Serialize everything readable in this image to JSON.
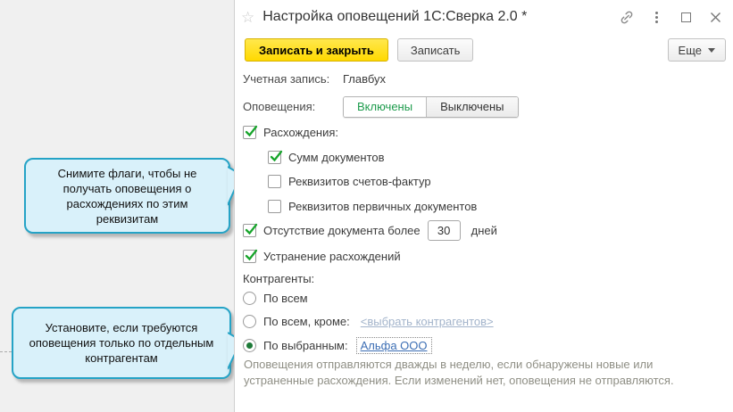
{
  "colors": {
    "accent_yellow": "#ffdd00",
    "check_green": "#18a52c",
    "toggle_green_text": "#1d9b4c",
    "callout_border": "#25a3c6",
    "callout_bg": "#d9f1fa",
    "link_blue": "#3c6eb4",
    "link_pale": "#a3b4cb",
    "footer_gray": "#8f8f85"
  },
  "window": {
    "title": "Настройка оповещений 1С:Сверка 2.0 *",
    "star_icon": "favorite-star-icon",
    "titlebar_icons": [
      "copy-link-icon",
      "kebab-menu-icon",
      "maximize-icon",
      "close-icon"
    ]
  },
  "toolbar": {
    "save_and_close": "Записать и закрыть",
    "save": "Записать",
    "more": "Еще"
  },
  "form": {
    "account": {
      "label": "Учетная запись:",
      "value": "Главбух"
    },
    "notifications": {
      "label": "Оповещения:",
      "enabled_option": "Включены",
      "disabled_option": "Выключены",
      "selected": "Включены"
    },
    "discrepancies": {
      "label": "Расхождения:",
      "checked": true,
      "items": [
        {
          "label": "Сумм документов",
          "checked": true
        },
        {
          "label": "Реквизитов счетов-фактур",
          "checked": false
        },
        {
          "label": "Реквизитов первичных документов",
          "checked": false
        }
      ]
    },
    "absence": {
      "label": "Отсутствие документа более",
      "value": "30",
      "suffix": "дней",
      "checked": true
    },
    "resolution": {
      "label": "Устранение расхождений",
      "checked": true
    },
    "counterparties": {
      "label": "Контрагенты:",
      "options": [
        {
          "label": "По всем",
          "selected": false,
          "link": ""
        },
        {
          "label": "По всем, кроме:",
          "selected": false,
          "link": "<выбрать контрагентов>"
        },
        {
          "label": "По выбранным:",
          "selected": true,
          "link": "Альфа ООО"
        }
      ]
    },
    "footer": {
      "line1": "Оповещения отправляются дважды в неделю, если обнаружены новые или",
      "line2": "устраненные расхождения. Если изменений нет, оповещения не отправляются."
    }
  },
  "callouts": [
    {
      "text": "Снимите флаги, чтобы не получать оповещения о расхождениях по этим реквизитам"
    },
    {
      "text": "Установите, если требуются оповещения только по отдельным контрагентам"
    }
  ]
}
